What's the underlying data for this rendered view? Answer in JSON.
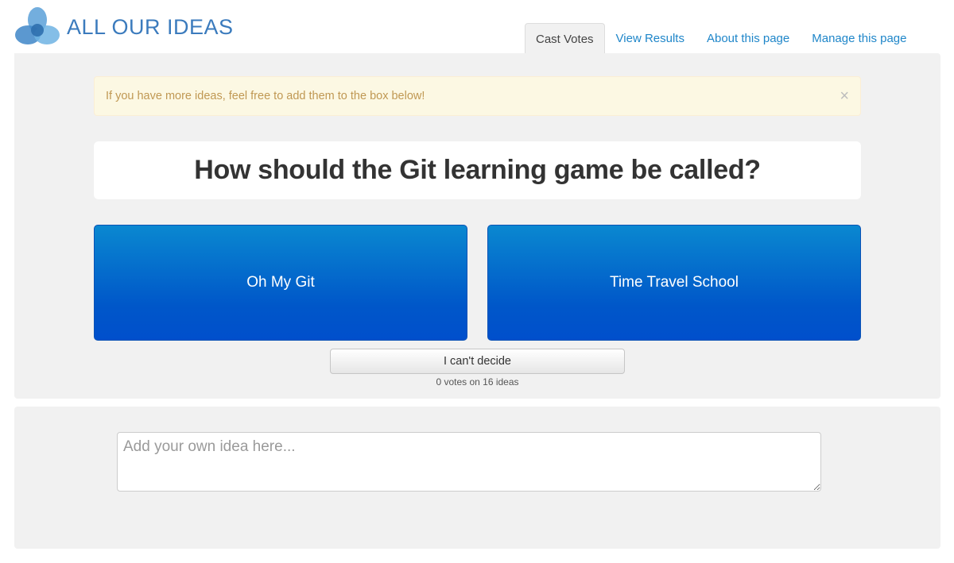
{
  "header": {
    "logo_text": "ALL OUR IDEAS",
    "logo_icon": "trefoil-logo-icon"
  },
  "tabs": [
    {
      "label": "Cast Votes",
      "active": true
    },
    {
      "label": "View Results",
      "active": false
    },
    {
      "label": "About this page",
      "active": false
    },
    {
      "label": "Manage this page",
      "active": false
    }
  ],
  "alert": {
    "message": "If you have more ideas, feel free to add them to the box below!",
    "close_glyph": "×"
  },
  "question": "How should the Git learning game be called?",
  "choices": {
    "left": "Oh My Git",
    "right": "Time Travel School"
  },
  "cant_decide_label": "I can't decide",
  "vote_count_text": "0 votes on 16 ideas",
  "idea_input": {
    "placeholder": "Add your own idea here...",
    "value": ""
  },
  "colors": {
    "accent_link": "#1f86c9",
    "choice_button_top": "#0a88d0",
    "choice_button_bottom": "#004fcc",
    "alert_bg": "#fcf8e3",
    "alert_text": "#c09853",
    "panel_bg": "#f1f1f1"
  }
}
